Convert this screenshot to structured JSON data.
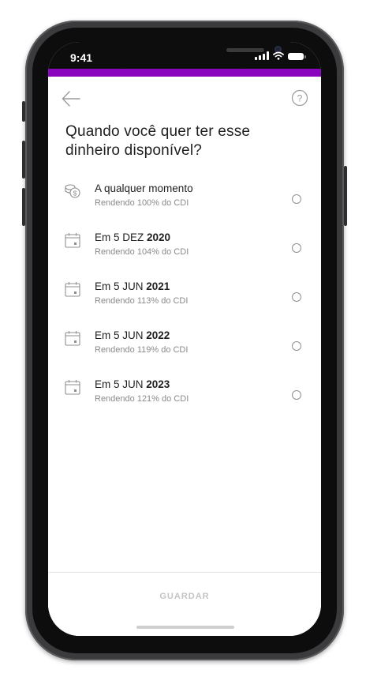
{
  "status": {
    "time": "9:41"
  },
  "header": {
    "back_icon": "arrow-left-icon",
    "help_icon": "help-circle-icon"
  },
  "question": "Quando você quer ter esse dinheiro disponível?",
  "options": [
    {
      "icon": "coins-icon",
      "prefix": "A qualquer momento",
      "year": "",
      "subtitle": "Rendendo 100% do CDI",
      "selected": false
    },
    {
      "icon": "calendar-icon",
      "prefix": "Em 5 DEZ ",
      "year": "2020",
      "subtitle": "Rendendo 104% do CDI",
      "selected": false
    },
    {
      "icon": "calendar-icon",
      "prefix": "Em 5 JUN ",
      "year": "2021",
      "subtitle": "Rendendo 113% do CDI",
      "selected": false
    },
    {
      "icon": "calendar-icon",
      "prefix": "Em 5 JUN ",
      "year": "2022",
      "subtitle": "Rendendo 119% do CDI",
      "selected": false
    },
    {
      "icon": "calendar-icon",
      "prefix": "Em 5 JUN ",
      "year": "2023",
      "subtitle": "Rendendo 121% do CDI",
      "selected": false
    }
  ],
  "footer": {
    "save_label": "GUARDAR"
  },
  "colors": {
    "accent": "#8a05be",
    "text": "#1f1f1f",
    "muted": "#8a8a8a",
    "disabled": "#c4c4c4"
  }
}
